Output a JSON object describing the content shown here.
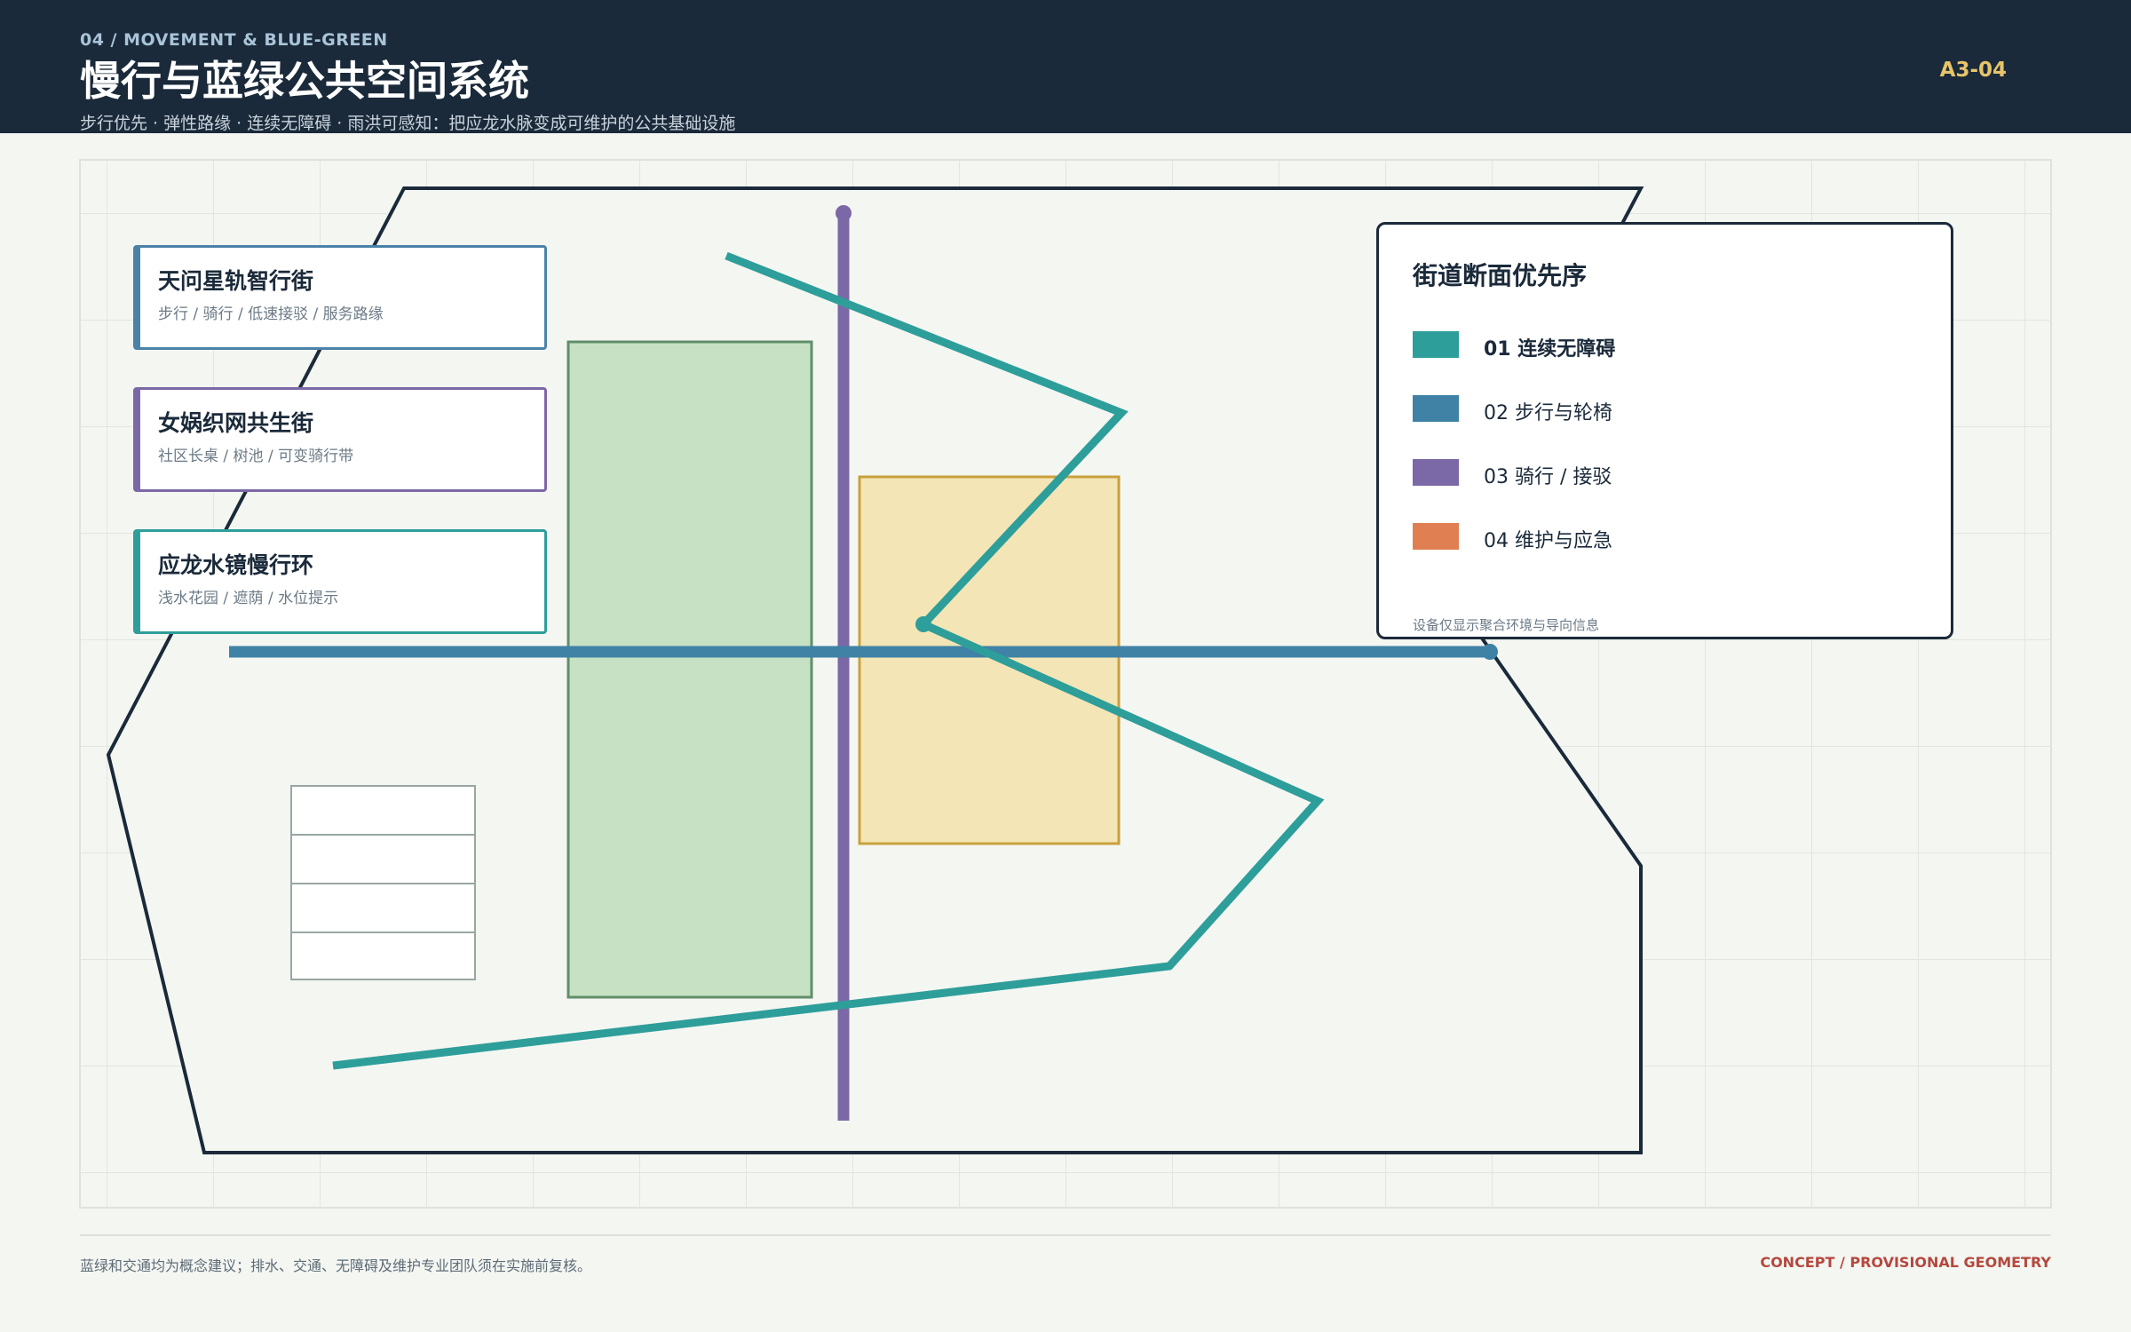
{
  "header": {
    "eyebrow": "04 / MOVEMENT & BLUE-GREEN",
    "title": "慢行与蓝绿公共空间系统",
    "subtitle": "步行优先 · 弹性路缘 · 连续无障碍 · 雨洪可感知：把应龙水脉变成可维护的公共基础设施",
    "sheet_code": "A3-04"
  },
  "streets": [
    {
      "title": "天问星轨智行街",
      "subtitle": "步行 / 骑行 / 低速接驳 / 服务路缘",
      "color": "#4a82a8"
    },
    {
      "title": "女娲织网共生街",
      "subtitle": "社区长桌 / 树池 / 可变骑行带",
      "color": "#7b68a6"
    },
    {
      "title": "应龙水镜慢行环",
      "subtitle": "浅水花园 / 遮荫 / 水位提示",
      "color": "#2e9e9a"
    }
  ],
  "legend": {
    "title": "街道断面优先序",
    "items": [
      {
        "label": "01  连续无障碍",
        "color": "#2e9e9a",
        "bold": true
      },
      {
        "label": "02  步行与轮椅",
        "color": "#3f82a6",
        "bold": false
      },
      {
        "label": "03  骑行 / 接驳",
        "color": "#7b68a6",
        "bold": false
      },
      {
        "label": "04  维护与应急",
        "color": "#e07f52",
        "bold": false
      }
    ],
    "note": "设备仅显示聚合环境与导向信息"
  },
  "footer": {
    "note": "蓝绿和交通均为概念建议；排水、交通、无障碍及维护专业团队须在实施前复核。",
    "tag": "CONCEPT / PROVISIONAL GEOMETRY"
  },
  "colors": {
    "navy": "#1b2a3a",
    "teal": "#2e9e9a",
    "blue": "#3f82a6",
    "purple": "#7b68a6",
    "green_fill": "#c7e1c5",
    "green_stroke": "#5f8f69",
    "yellow_fill": "#f3e5b6",
    "yellow_stroke": "#c9a13d"
  }
}
